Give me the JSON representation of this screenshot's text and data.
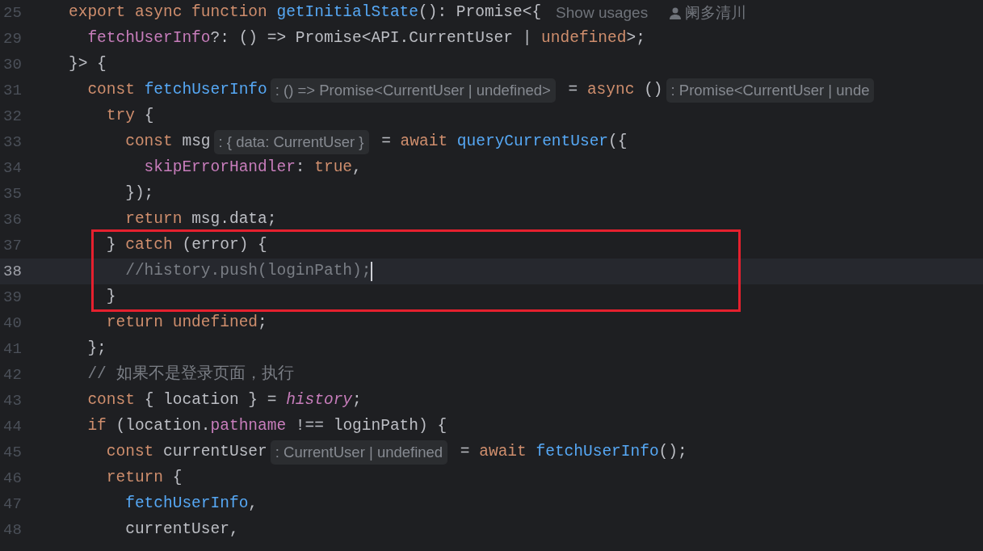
{
  "editor": {
    "lines": [
      {
        "number": "25",
        "current": false,
        "boxed": false,
        "tokens": [
          {
            "kind": "keyword",
            "text": "export async function "
          },
          {
            "kind": "function",
            "text": "getInitialState"
          },
          {
            "kind": "plain",
            "text": "(): Promise<{"
          },
          {
            "kind": "meta",
            "text": "Show usages"
          },
          {
            "kind": "author",
            "text": "阑多清川"
          }
        ]
      },
      {
        "number": "29",
        "current": false,
        "boxed": false,
        "tokens": [
          {
            "kind": "property",
            "text": "  fetchUserInfo"
          },
          {
            "kind": "plain",
            "text": "?: () => Promise<API.CurrentUser | "
          },
          {
            "kind": "keyword",
            "text": "undefined"
          },
          {
            "kind": "plain",
            "text": ">;"
          }
        ]
      },
      {
        "number": "30",
        "current": false,
        "boxed": false,
        "tokens": [
          {
            "kind": "plain",
            "text": "}> {"
          }
        ]
      },
      {
        "number": "31",
        "current": false,
        "boxed": false,
        "tokens": [
          {
            "kind": "keyword",
            "text": "  const "
          },
          {
            "kind": "function",
            "text": "fetchUserInfo"
          },
          {
            "kind": "hint",
            "text": ": () => Promise<CurrentUser | undefined>"
          },
          {
            "kind": "plain",
            "text": " = "
          },
          {
            "kind": "keyword",
            "text": "async "
          },
          {
            "kind": "plain",
            "text": "()"
          },
          {
            "kind": "hint",
            "text": ": Promise<CurrentUser | unde"
          }
        ]
      },
      {
        "number": "32",
        "current": false,
        "boxed": false,
        "tokens": [
          {
            "kind": "keyword",
            "text": "    try "
          },
          {
            "kind": "plain",
            "text": "{"
          }
        ]
      },
      {
        "number": "33",
        "current": false,
        "boxed": false,
        "tokens": [
          {
            "kind": "keyword",
            "text": "      const "
          },
          {
            "kind": "plain",
            "text": "msg"
          },
          {
            "kind": "hint",
            "text": ": { data: CurrentUser }"
          },
          {
            "kind": "plain",
            "text": " = "
          },
          {
            "kind": "keyword",
            "text": "await "
          },
          {
            "kind": "function",
            "text": "queryCurrentUser"
          },
          {
            "kind": "plain",
            "text": "({"
          }
        ]
      },
      {
        "number": "34",
        "current": false,
        "boxed": false,
        "tokens": [
          {
            "kind": "property",
            "text": "        skipErrorHandler"
          },
          {
            "kind": "plain",
            "text": ": "
          },
          {
            "kind": "keyword",
            "text": "true"
          },
          {
            "kind": "plain",
            "text": ","
          }
        ]
      },
      {
        "number": "35",
        "current": false,
        "boxed": false,
        "tokens": [
          {
            "kind": "plain",
            "text": "      });"
          }
        ]
      },
      {
        "number": "36",
        "current": false,
        "boxed": false,
        "tokens": [
          {
            "kind": "keyword",
            "text": "      return "
          },
          {
            "kind": "plain",
            "text": "msg.data;"
          }
        ]
      },
      {
        "number": "37",
        "current": false,
        "boxed": true,
        "tokens": [
          {
            "kind": "plain",
            "text": "    } "
          },
          {
            "kind": "keyword",
            "text": "catch "
          },
          {
            "kind": "plain",
            "text": "(error) {"
          }
        ]
      },
      {
        "number": "38",
        "current": true,
        "boxed": true,
        "tokens": [
          {
            "kind": "comment",
            "text": "      //history.push(loginPath);"
          }
        ]
      },
      {
        "number": "39",
        "current": false,
        "boxed": true,
        "tokens": [
          {
            "kind": "plain",
            "text": "    }"
          }
        ]
      },
      {
        "number": "40",
        "current": false,
        "boxed": false,
        "tokens": [
          {
            "kind": "keyword",
            "text": "    return undefined"
          },
          {
            "kind": "plain",
            "text": ";"
          }
        ]
      },
      {
        "number": "41",
        "current": false,
        "boxed": false,
        "tokens": [
          {
            "kind": "plain",
            "text": "  };"
          }
        ]
      },
      {
        "number": "42",
        "current": false,
        "boxed": false,
        "tokens": [
          {
            "kind": "comment",
            "text": "  // 如果不是登录页面，执行"
          }
        ]
      },
      {
        "number": "43",
        "current": false,
        "boxed": false,
        "tokens": [
          {
            "kind": "keyword",
            "text": "  const "
          },
          {
            "kind": "plain",
            "text": "{ location } = "
          },
          {
            "kind": "global",
            "text": "history"
          },
          {
            "kind": "plain",
            "text": ";"
          }
        ]
      },
      {
        "number": "44",
        "current": false,
        "boxed": false,
        "tokens": [
          {
            "kind": "keyword",
            "text": "  if "
          },
          {
            "kind": "plain",
            "text": "(location."
          },
          {
            "kind": "property",
            "text": "pathname"
          },
          {
            "kind": "plain",
            "text": " !== loginPath) {"
          }
        ]
      },
      {
        "number": "45",
        "current": false,
        "boxed": false,
        "tokens": [
          {
            "kind": "keyword",
            "text": "    const "
          },
          {
            "kind": "plain",
            "text": "currentUser"
          },
          {
            "kind": "hint",
            "text": ": CurrentUser | undefined"
          },
          {
            "kind": "plain",
            "text": " = "
          },
          {
            "kind": "keyword",
            "text": "await "
          },
          {
            "kind": "function",
            "text": "fetchUserInfo"
          },
          {
            "kind": "plain",
            "text": "();"
          }
        ]
      },
      {
        "number": "46",
        "current": false,
        "boxed": false,
        "tokens": [
          {
            "kind": "keyword",
            "text": "    return "
          },
          {
            "kind": "plain",
            "text": "{"
          }
        ]
      },
      {
        "number": "47",
        "current": false,
        "boxed": false,
        "tokens": [
          {
            "kind": "function",
            "text": "      fetchUserInfo"
          },
          {
            "kind": "plain",
            "text": ","
          }
        ]
      },
      {
        "number": "48",
        "current": false,
        "boxed": false,
        "tokens": [
          {
            "kind": "plain",
            "text": "      currentUser,"
          }
        ]
      }
    ]
  }
}
